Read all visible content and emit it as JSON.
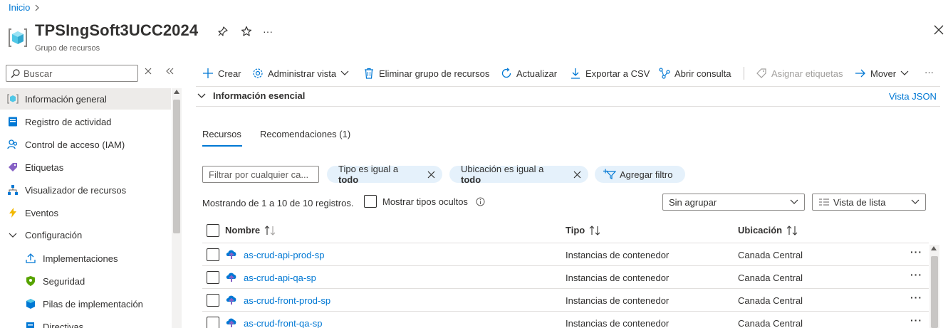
{
  "breadcrumb": {
    "home": "Inicio",
    "sep": ">"
  },
  "resource": {
    "title": "TPSIngSoft3UCC2024",
    "subtitle": "Grupo de recursos",
    "more": "···"
  },
  "sidebar": {
    "search_placeholder": "Buscar",
    "items": [
      {
        "label": "Información general",
        "icon": "resource-group-icon"
      },
      {
        "label": "Registro de actividad",
        "icon": "activity-log-icon"
      },
      {
        "label": "Control de acceso (IAM)",
        "icon": "people-icon"
      },
      {
        "label": "Etiquetas",
        "icon": "tag-icon"
      },
      {
        "label": "Visualizador de recursos",
        "icon": "hierarchy-icon"
      },
      {
        "label": "Eventos",
        "icon": "lightning-icon"
      },
      {
        "label": "Configuración",
        "icon": "chevron-down-icon"
      },
      {
        "label": "Implementaciones",
        "icon": "upload-icon"
      },
      {
        "label": "Seguridad",
        "icon": "shield-icon"
      },
      {
        "label": "Pilas de implementación",
        "icon": "cube-stack-icon"
      },
      {
        "label": "Directivas",
        "icon": "policy-icon"
      }
    ]
  },
  "toolbar": {
    "create": "Crear",
    "manage_view": "Administrar vista",
    "delete_group": "Eliminar grupo de recursos",
    "refresh": "Actualizar",
    "export_csv": "Exportar a CSV",
    "open_query": "Abrir consulta",
    "assign_tags": "Asignar etiquetas",
    "move": "Mover",
    "more": "···"
  },
  "essentials": {
    "label": "Información esencial",
    "json_view": "Vista JSON"
  },
  "tabs": [
    {
      "label": "Recursos"
    },
    {
      "label": "Recomendaciones (1)"
    }
  ],
  "filters": {
    "placeholder": "Filtrar por cualquier ca...",
    "pills": [
      {
        "prefix": "Tipo es igual a ",
        "value": "todo"
      },
      {
        "prefix": "Ubicación es igual a ",
        "value": "todo"
      }
    ],
    "add_filter": "Agregar filtro"
  },
  "listing": {
    "showing": "Mostrando de 1 a 10 de 10 registros.",
    "show_hidden": "Mostrar tipos ocultos",
    "group_by": "Sin agrupar",
    "view_mode": "Vista de lista"
  },
  "table": {
    "columns": {
      "name": "Nombre",
      "type": "Tipo",
      "location": "Ubicación"
    },
    "rows": [
      {
        "name": "as-crud-api-prod-sp",
        "type": "Instancias de contenedor",
        "location": "Canada Central"
      },
      {
        "name": "as-crud-api-qa-sp",
        "type": "Instancias de contenedor",
        "location": "Canada Central"
      },
      {
        "name": "as-crud-front-prod-sp",
        "type": "Instancias de contenedor",
        "location": "Canada Central"
      },
      {
        "name": "as-crud-front-qa-sp",
        "type": "Instancias de contenedor",
        "location": "Canada Central"
      }
    ],
    "row_more": "···"
  },
  "colors": {
    "accent": "#0078d4",
    "pill_bg": "#e5f1fb",
    "active_nav": "#edebe9"
  }
}
